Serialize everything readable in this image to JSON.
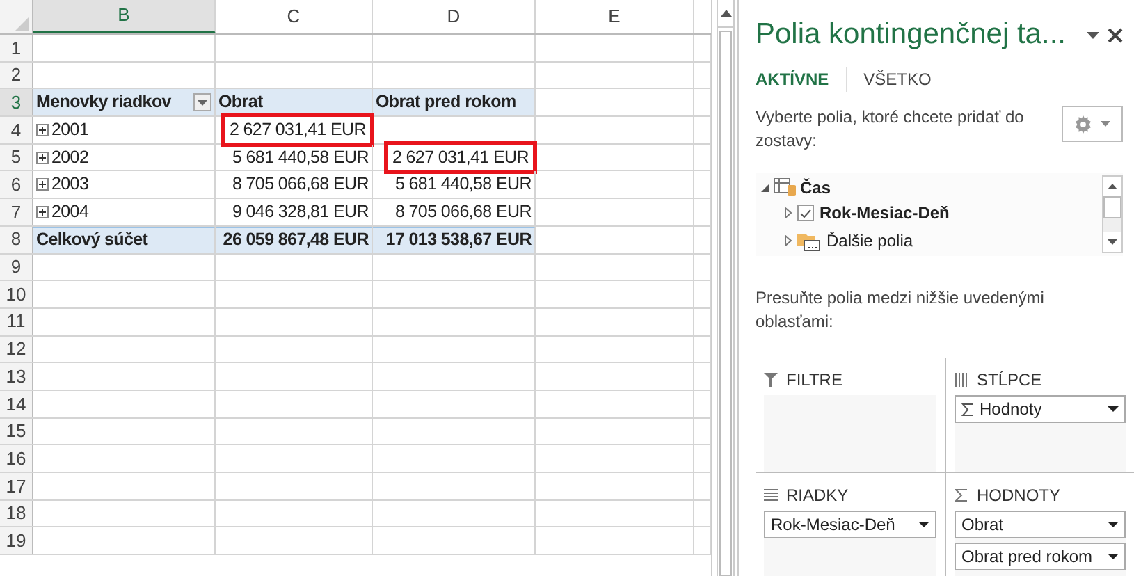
{
  "sheet": {
    "columns": [
      {
        "label": "B",
        "selected": true
      },
      {
        "label": "C",
        "selected": false
      },
      {
        "label": "D",
        "selected": false
      },
      {
        "label": "E",
        "selected": false
      }
    ],
    "rows": [
      {
        "number": "1"
      },
      {
        "number": "2"
      },
      {
        "number": "3",
        "kind": "header",
        "cells": [
          {
            "text": "Menovky riadkov",
            "filter": true
          },
          {
            "text": "Obrat"
          },
          {
            "text": "Obrat pred rokom"
          }
        ]
      },
      {
        "number": "4",
        "kind": "item",
        "cells": [
          {
            "text": "2001"
          },
          {
            "text": "2 627 031,41 EUR",
            "highlighted": true
          },
          {
            "text": ""
          }
        ]
      },
      {
        "number": "5",
        "kind": "item",
        "cells": [
          {
            "text": "2002"
          },
          {
            "text": "5 681 440,58 EUR"
          },
          {
            "text": "2 627 031,41 EUR",
            "highlighted": true
          }
        ]
      },
      {
        "number": "6",
        "kind": "item",
        "cells": [
          {
            "text": "2003"
          },
          {
            "text": "8 705 066,68 EUR"
          },
          {
            "text": "5 681 440,58 EUR"
          }
        ]
      },
      {
        "number": "7",
        "kind": "item",
        "cells": [
          {
            "text": "2004"
          },
          {
            "text": "9 046 328,81 EUR"
          },
          {
            "text": "8 705 066,68 EUR"
          }
        ]
      },
      {
        "number": "8",
        "kind": "total",
        "cells": [
          {
            "text": "Celkový súčet"
          },
          {
            "text": "26 059 867,48 EUR"
          },
          {
            "text": "17 013 538,67 EUR"
          }
        ]
      },
      {
        "number": "9"
      },
      {
        "number": "10"
      },
      {
        "number": "11"
      },
      {
        "number": "12"
      },
      {
        "number": "13"
      },
      {
        "number": "14"
      },
      {
        "number": "15"
      },
      {
        "number": "16"
      },
      {
        "number": "17"
      },
      {
        "number": "18"
      },
      {
        "number": "19"
      }
    ]
  },
  "panel": {
    "title": "Polia kontingenčnej ta...",
    "tabs": [
      {
        "label": "AKTÍVNE",
        "selected": true
      },
      {
        "label": "VŠETKO",
        "selected": false
      }
    ],
    "instruction": "Vyberte polia, ktoré chcete pridať do zostavy:",
    "tree": [
      {
        "label": "Čas",
        "expanded": true,
        "children": [
          {
            "label": "Rok-Mesiac-Deň",
            "kind": "field",
            "checked": true
          },
          {
            "label": "Ďalšie polia",
            "kind": "folder"
          }
        ]
      }
    ],
    "areas_hint": "Presuňte polia medzi nižšie uvedenými oblasťami:",
    "areas": [
      {
        "kind": "filter",
        "label": "FILTRE"
      },
      {
        "kind": "columns",
        "label": "STĹPCE",
        "items": [
          {
            "label": "Hodnoty",
            "sigma": true
          }
        ]
      },
      {
        "kind": "rows",
        "label": "RIADKY",
        "items": [
          {
            "label": "Rok-Mesiac-Deň"
          }
        ]
      },
      {
        "kind": "values",
        "label": "HODNOTY",
        "items": [
          {
            "label": "Obrat"
          },
          {
            "label": "Obrat pred rokom"
          }
        ]
      }
    ]
  }
}
